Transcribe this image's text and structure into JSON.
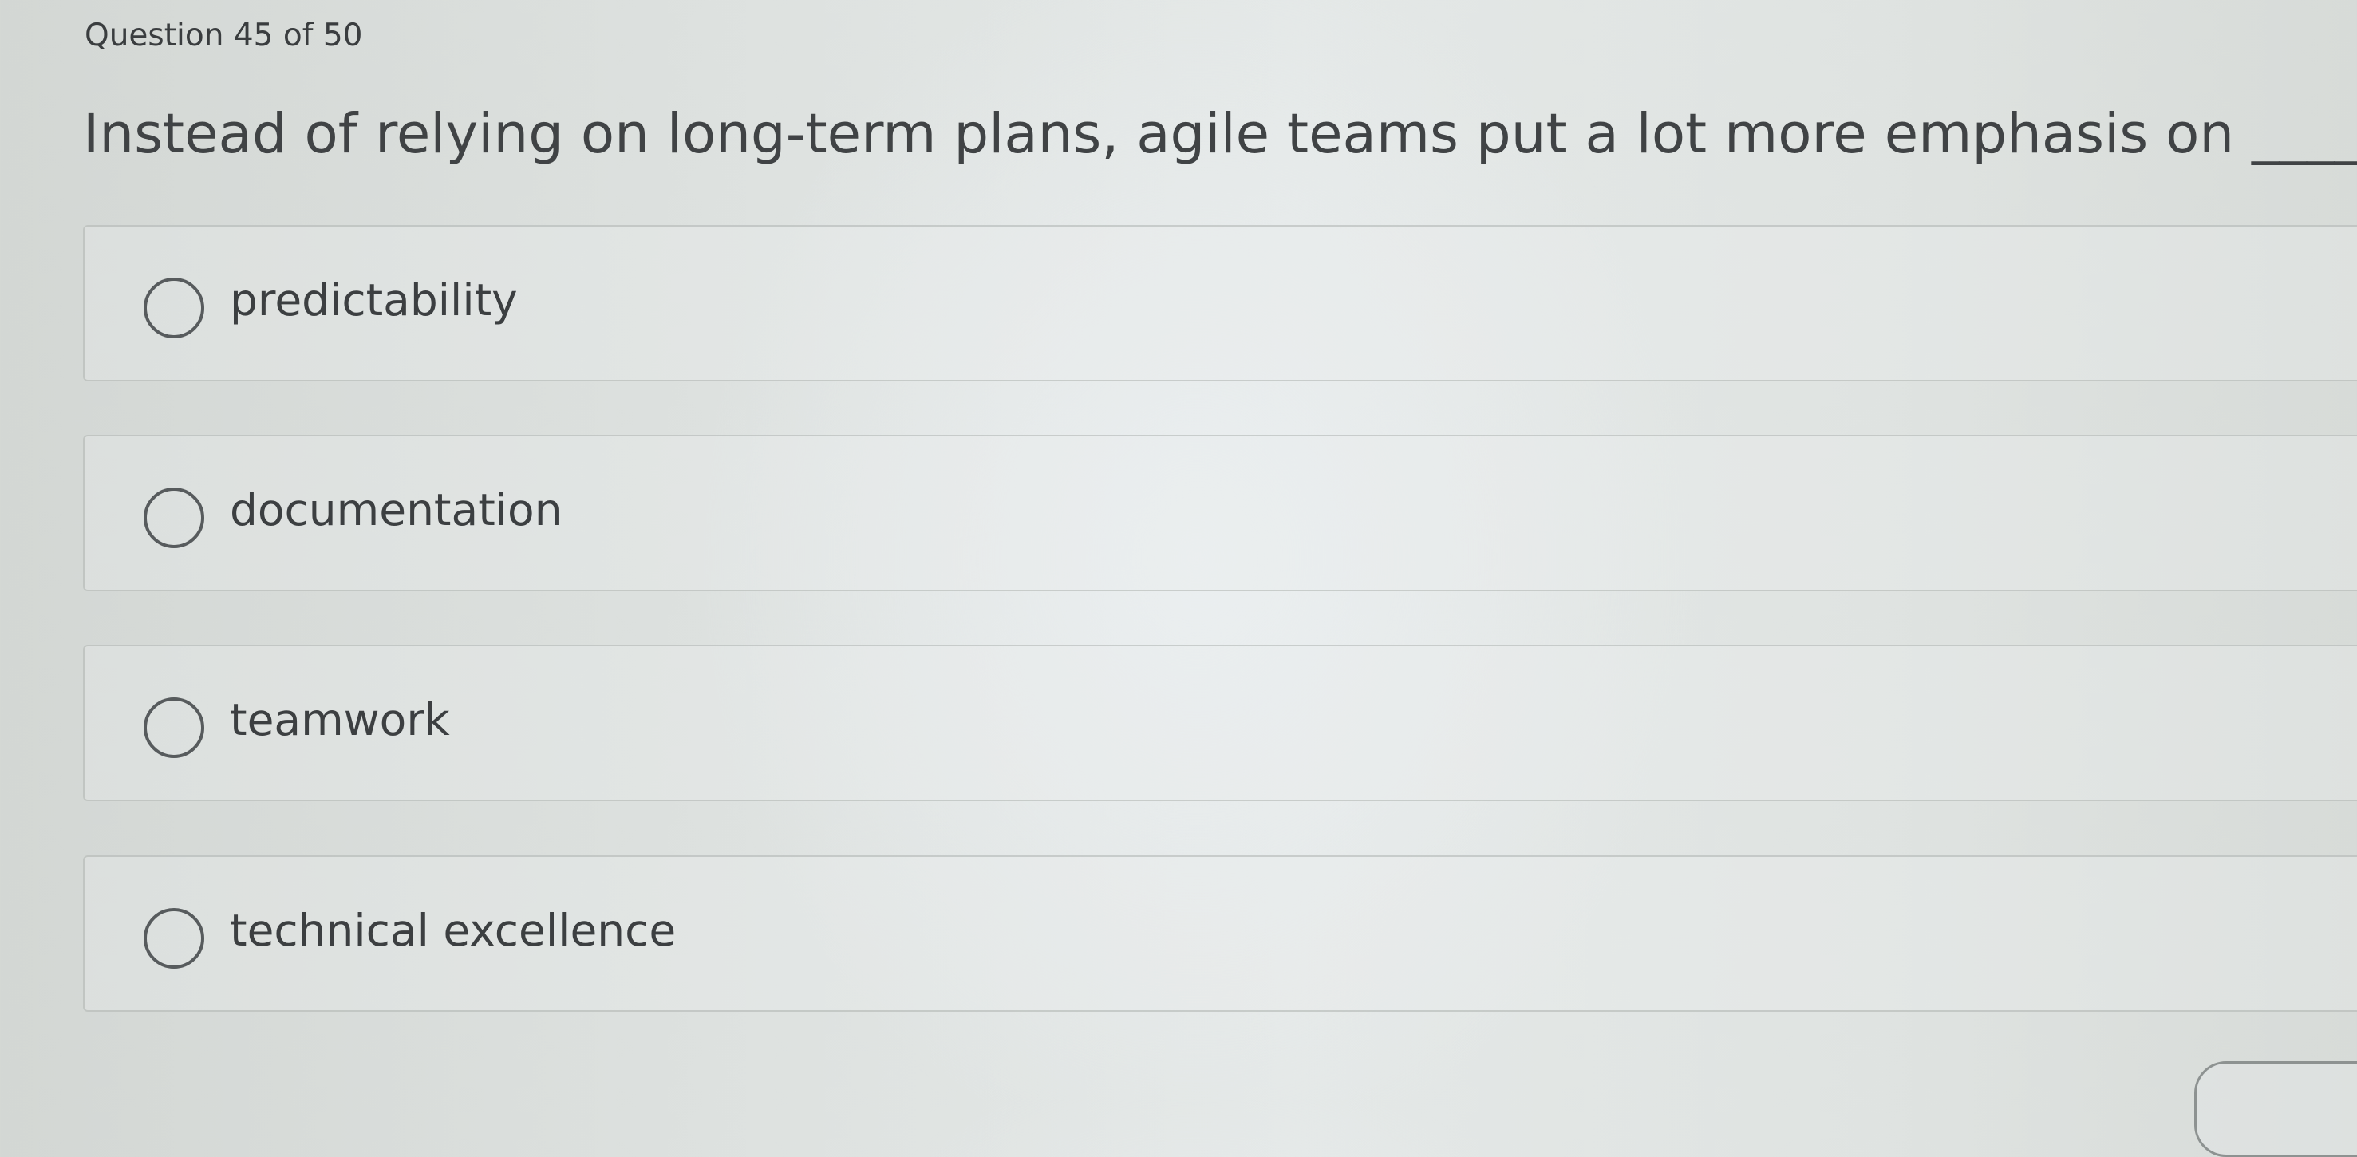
{
  "quiz": {
    "counter": "Question 45 of 50",
    "question": "Instead of relying on long-term plans, agile teams put a lot more emphasis on _____.",
    "options": [
      {
        "label": "predictability",
        "selected": false
      },
      {
        "label": "documentation",
        "selected": false
      },
      {
        "label": "teamwork",
        "selected": false
      },
      {
        "label": "technical excellence",
        "selected": false
      }
    ]
  }
}
